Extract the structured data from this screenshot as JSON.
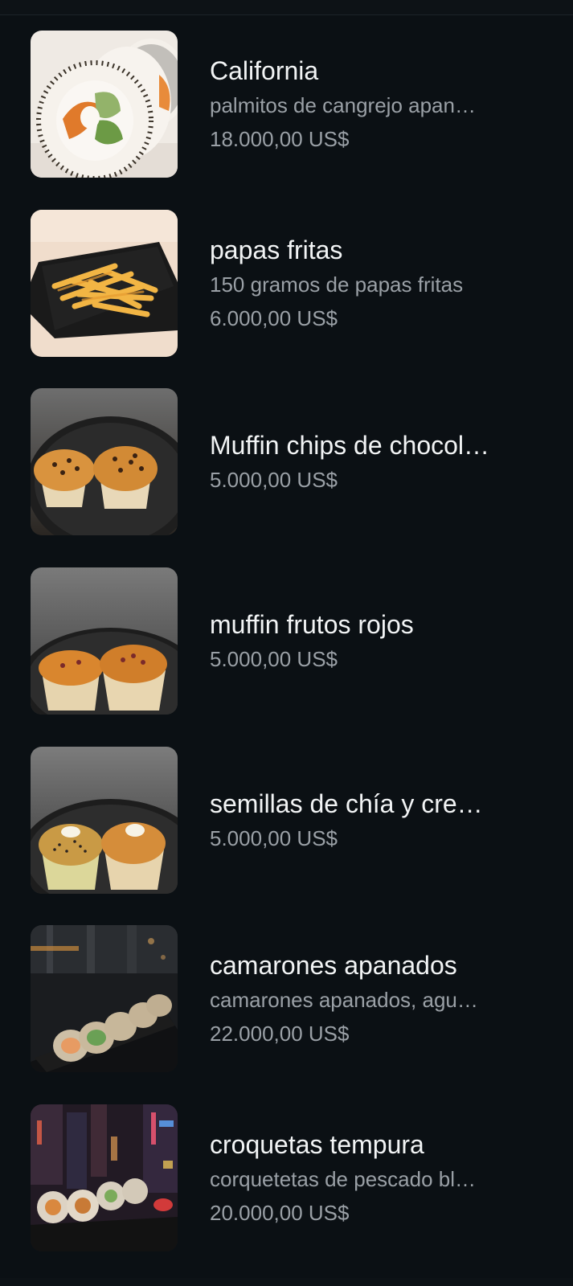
{
  "items": [
    {
      "name": "California",
      "description": "palmitos de cangrejo apan…",
      "price": "18.000,00 US$",
      "image": "sushi-roll-image"
    },
    {
      "name": "papas fritas",
      "description": "150 gramos de papas fritas",
      "price": "6.000,00 US$",
      "image": "french-fries-image"
    },
    {
      "name": "Muffin chips de chocol…",
      "price": "5.000,00 US$",
      "image": "chocolate-chip-muffins-image"
    },
    {
      "name": "muffin frutos rojos",
      "price": "5.000,00 US$",
      "image": "berry-muffins-image"
    },
    {
      "name": "semillas de chía y cre…",
      "price": "5.000,00 US$",
      "image": "chia-seed-muffins-image"
    },
    {
      "name": "camarones apanados",
      "description": "camarones apanados, agu…",
      "price": "22.000,00 US$",
      "image": "shrimp-roll-image"
    },
    {
      "name": "croquetas tempura",
      "description": "corquetetas de pescado bl…",
      "price": "20.000,00 US$",
      "image": "tempura-roll-image"
    }
  ],
  "colors": {
    "background": "#0b1014",
    "title": "#f2f4f5",
    "secondary_text": "#9aa0a6"
  }
}
